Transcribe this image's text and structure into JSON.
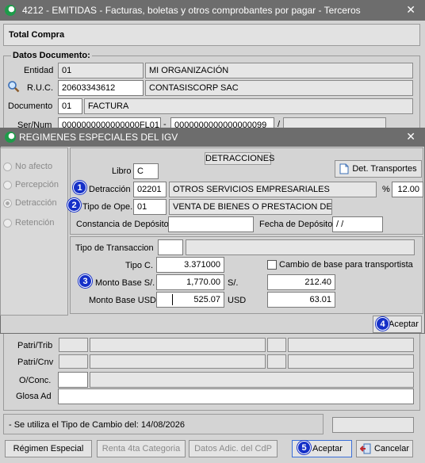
{
  "main_window": {
    "title": "4212 - EMITIDAS - Facturas, boletas y otros comprobantes por pagar - Terceros",
    "close": "✕",
    "total_compra": "Total Compra",
    "datos_documento": "Datos Documento:",
    "entidad_label": "Entidad",
    "entidad_code": "01",
    "entidad_name": "MI ORGANIZACIÓN",
    "ruc_label": "R.U.C.",
    "ruc_value": "20603343612",
    "ruc_name": "CONTASISCORP SAC",
    "documento_label": "Documento",
    "documento_code": "01",
    "documento_name": "FACTURA",
    "sernum_label": "Ser/Num",
    "sernum_a": "0000000000000000FL01",
    "sernum_b": "0000000000000000099",
    "patri_trib": "Patri/Trib",
    "patri_cnv": "Patri/Cnv",
    "oconc": "O/Conc.",
    "glosa": "Glosa Ad",
    "tipo_cambio_note": "- Se utiliza el Tipo de Cambio del: 14/08/2026",
    "btn_regimen": "Régimen Especial",
    "btn_renta": "Renta 4ta Categoria",
    "btn_datos": "Datos Adic. del CdP",
    "btn_aceptar": "Aceptar",
    "btn_cancelar": "Cancelar"
  },
  "dialog": {
    "title": "REGIMENES ESPECIALES DEL IGV",
    "close": "✕",
    "radios": [
      "No afecto",
      "Percepción",
      "Detracción",
      "Retención"
    ],
    "detracciones_header": "DETRACCIONES",
    "libro_label": "Libro",
    "libro_value": "C",
    "btn_transportes": "Det. Transportes",
    "detraccion_label": "Detracción",
    "detraccion_code": "02201",
    "detraccion_name": "OTROS SERVICIOS EMPRESARIALES",
    "percent_symbol": "%",
    "percent_value": "12.00",
    "tipo_ope_label": "Tipo de Ope.",
    "tipo_ope_code": "01",
    "tipo_ope_name": "VENTA DE BIENES O PRESTACION DE SEI",
    "constancia_label": "Constancia de Depósito",
    "fecha_label": "Fecha de Depósito",
    "fecha_value": "/  /",
    "tipo_transaccion_label": "Tipo de Transaccion",
    "tipo_c_label": "Tipo C.",
    "tipo_c_value": "3.371000",
    "cambio_base_label": "Cambio de base para transportista",
    "monto_base_soles_label": "Monto Base S/.",
    "monto_base_soles_value": "1,770.00",
    "soles_label": "S/.",
    "soles_value": "212.40",
    "monto_base_usd_label": "Monto Base USD",
    "monto_base_usd_value": "525.07",
    "usd_label": "USD",
    "usd_value": "63.01",
    "btn_aceptar": "Aceptar"
  },
  "badges": [
    "1",
    "2",
    "3",
    "4",
    "5"
  ],
  "colors": {
    "titlebar": "#6d6d6d",
    "badge": "#1530c8",
    "logo": "#1e9b4a"
  }
}
